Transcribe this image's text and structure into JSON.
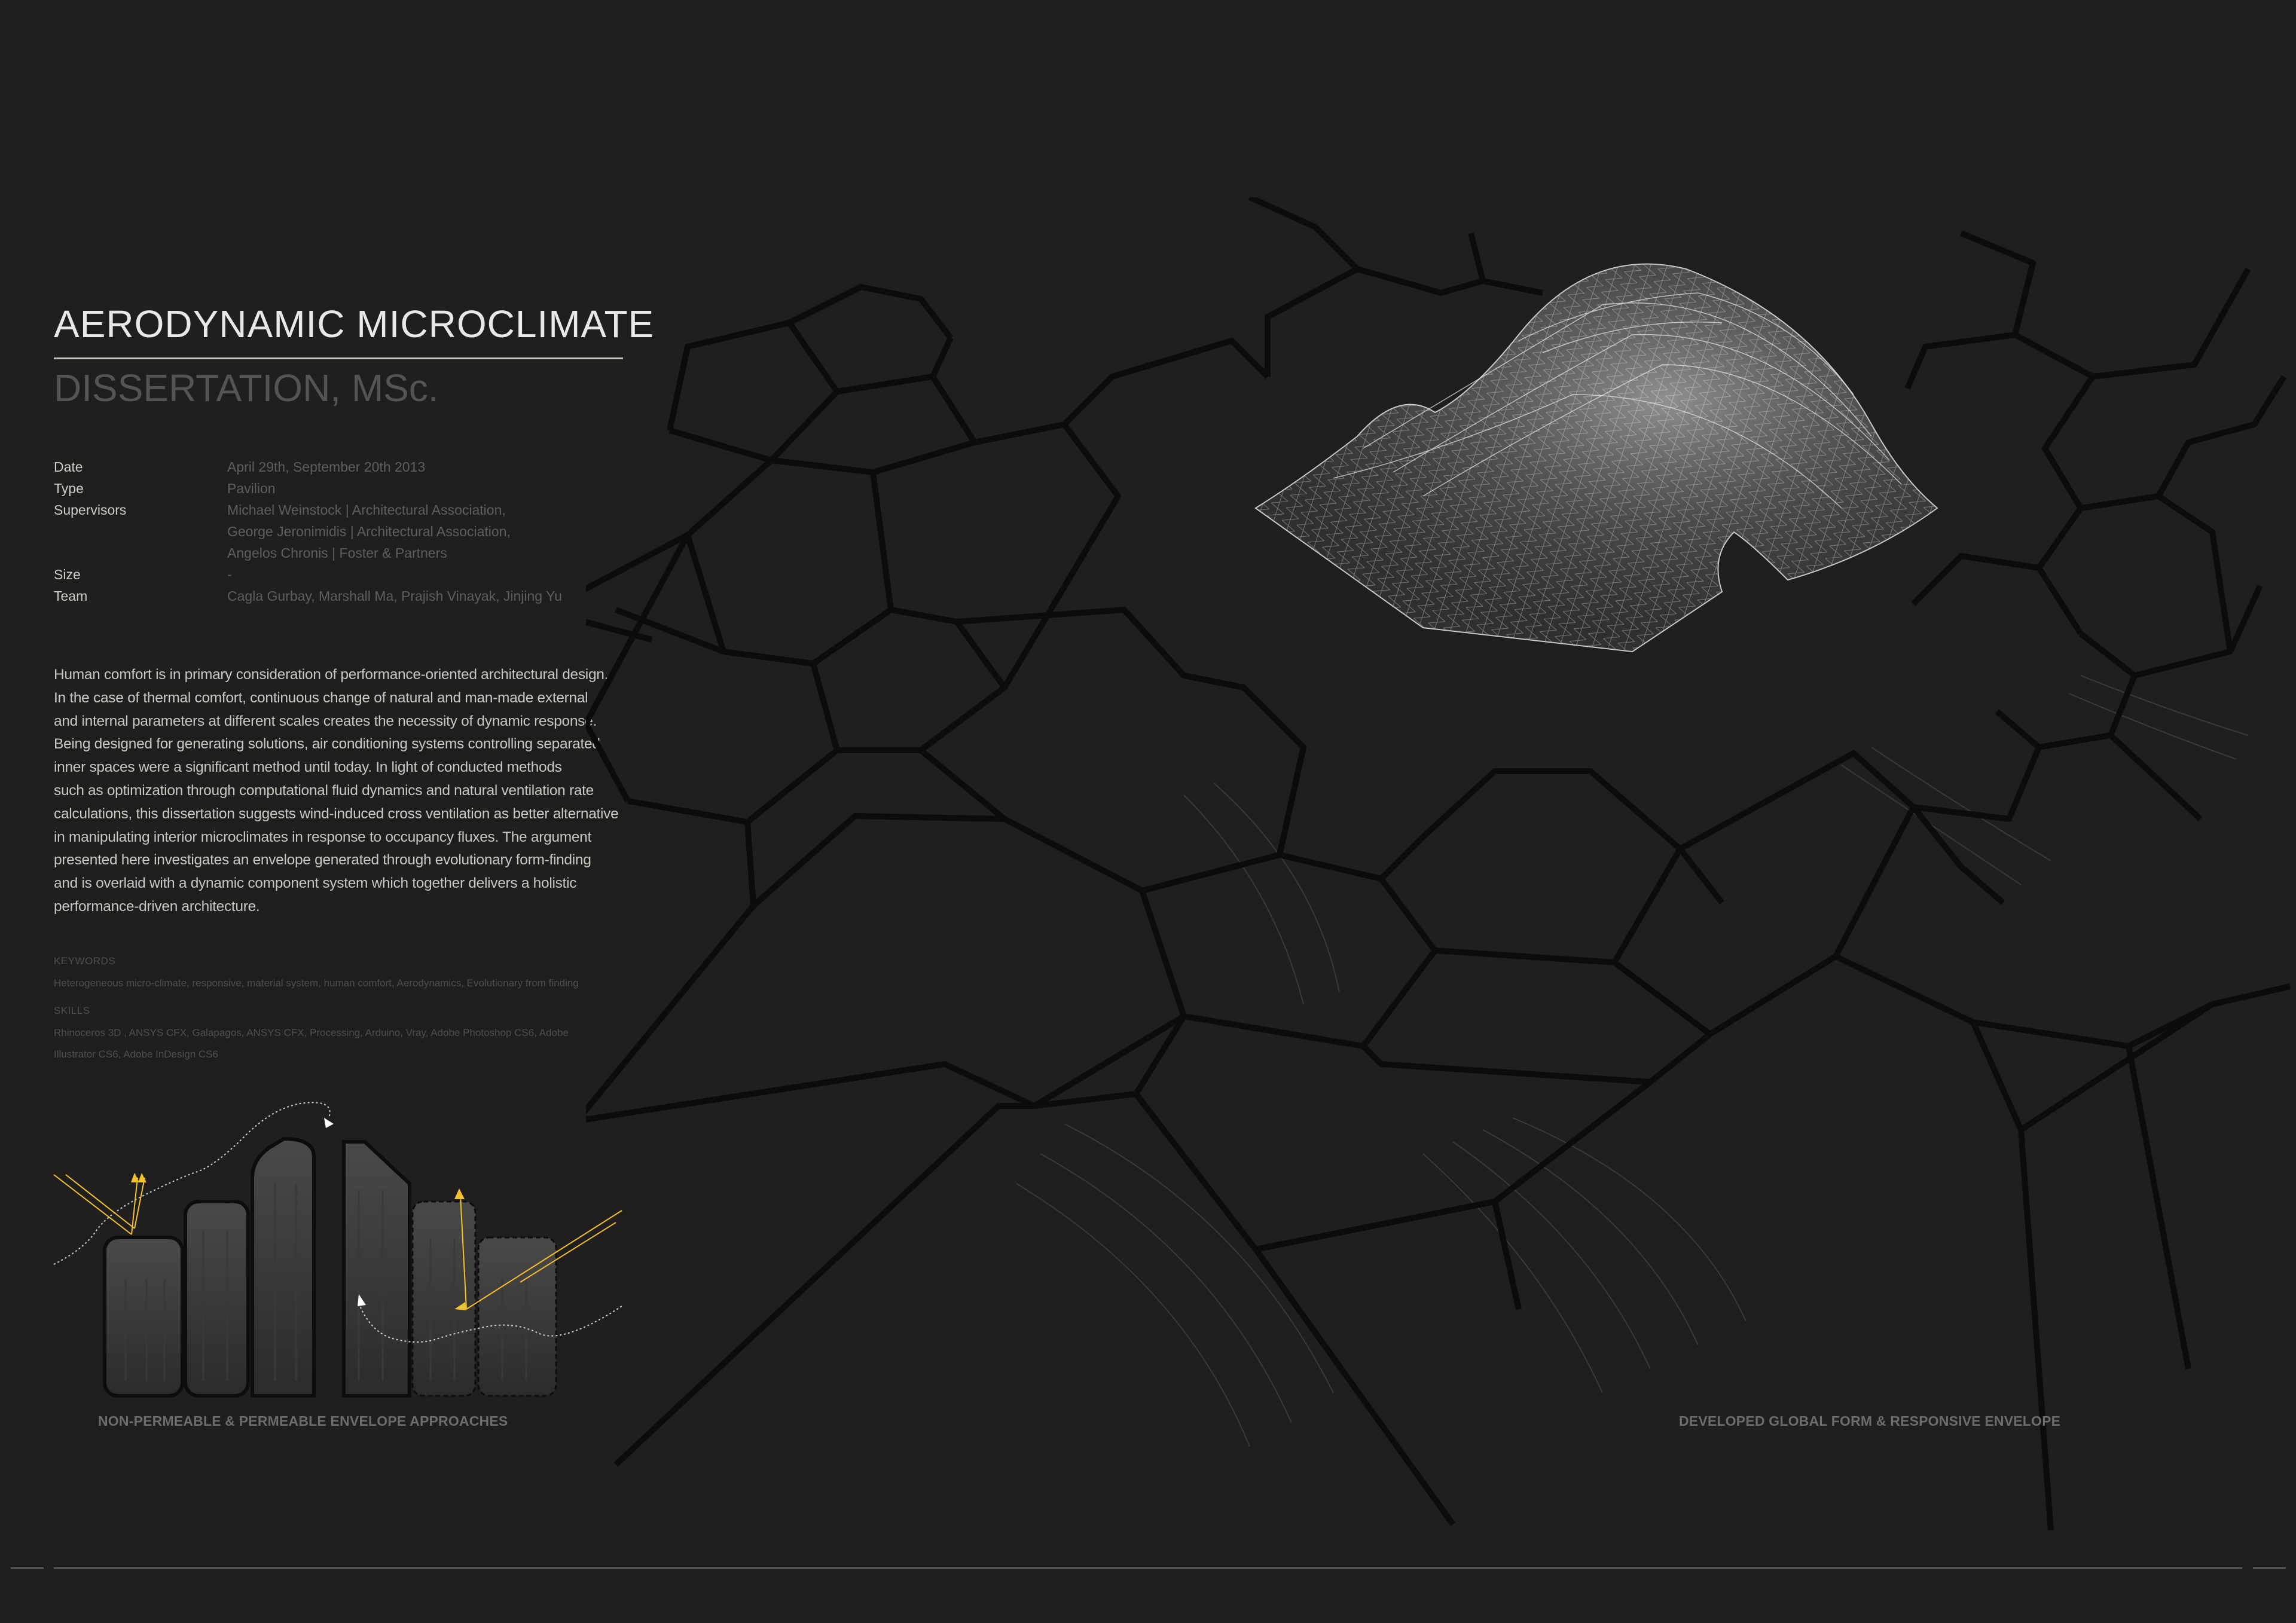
{
  "title": "AERODYNAMIC MICROCLIMATE",
  "subtitle": "DISSERTATION, MSc.",
  "info": [
    {
      "label": "Date",
      "value": "April 29th, September 20th 2013"
    },
    {
      "label": "Type",
      "value": "Pavilion"
    },
    {
      "label": "Supervisors",
      "value": "Michael Weinstock | Architectural Association,"
    },
    {
      "label": "",
      "value": "George Jeronimidis | Architectural Association,"
    },
    {
      "label": "",
      "value": "Angelos Chronis | Foster & Partners"
    },
    {
      "label": "Size",
      "value": "-"
    },
    {
      "label": "Team",
      "value": "Cagla Gurbay, Marshall Ma, Prajish Vinayak, Jinjing Yu"
    }
  ],
  "abstract_lines": [
    "Human comfort is in primary consideration of performance-oriented architectural design.",
    "In the case of thermal comfort, continuous change of natural and man-made external",
    "and internal parameters at different scales creates the necessity of dynamic response.",
    "Being designed for generating solutions, air conditioning systems controlling separated",
    "inner spaces were a significant method until today. In light of conducted methods",
    "such as optimization through computational fluid dynamics and natural ventilation rate",
    "calculations, this dissertation suggests wind-induced cross ventilation as better alternative",
    "in manipulating interior microclimates in response to occupancy fluxes. The argument",
    "presented here investigates an envelope generated through evolutionary form-finding",
    "and is overlaid with a dynamic component system which together delivers a holistic",
    "performance-driven architecture."
  ],
  "keywords": {
    "label": "KEYWORDS",
    "text": "Heterogeneous micro-climate, responsive, material system, human comfort, Aerodynamics, Evolutionary from finding"
  },
  "skills": {
    "label": "SKILLS",
    "line1": "Rhinoceros 3D , ANSYS CFX, Galapagos, ANSYS CFX, Processing, Arduino, Vray, Adobe Photoshop CS6, Adobe",
    "line2": "Illustrator CS6, Adobe InDesign CS6"
  },
  "captions": {
    "diagram": "NON-PERMEABLE & PERMEABLE ENVELOPE APPROACHES",
    "hero": "DEVELOPED GLOBAL FORM & RESPONSIVE ENVELOPE"
  },
  "colors": {
    "background": "#201f1e",
    "accent_yellow": "#f2c12e",
    "wire_white": "#e8e8e8",
    "cell_edge": "#0c0c0c"
  },
  "icons": {
    "hero": "voronoi-wireframe-canopy-render",
    "diagram": "building-envelope-sections-with-sun-rays"
  }
}
